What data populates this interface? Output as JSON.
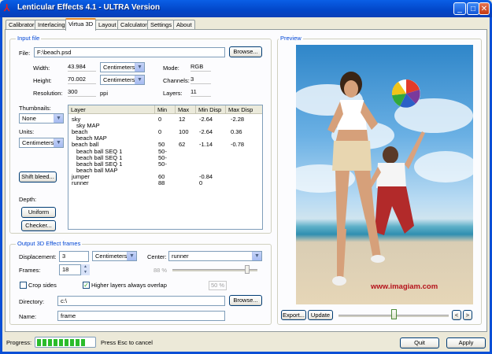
{
  "window": {
    "title": "Lenticular Effects 4.1 - ULTRA Version"
  },
  "tabs": [
    "Calibrator",
    "Interlacing",
    "Virtua 3D",
    "Layout",
    "Calculator",
    "Settings",
    "About"
  ],
  "input_file": {
    "group_title": "Input file",
    "file_label": "File:",
    "file_value": "F:\\beach.psd",
    "browse_label": "Browse...",
    "width_label": "Width:",
    "width_value": "43.984",
    "width_unit": "Centimeters",
    "height_label": "Height:",
    "height_value": "70.002",
    "height_unit": "Centimeters",
    "resolution_label": "Resolution:",
    "resolution_value": "300",
    "resolution_unit": "ppi",
    "mode_label": "Mode:",
    "mode_value": "RGB",
    "channels_label": "Channels:",
    "channels_value": "3",
    "layers_label": "Layers:",
    "layers_value": "11",
    "thumbnails_label": "Thumbnails:",
    "thumbnails_value": "None",
    "units_label": "Units:",
    "units_value": "Centimeters",
    "shift_bleed_label": "Shift bleed...",
    "depth_label": "Depth:",
    "uniform_label": "Uniform",
    "checker_label": "Checker..."
  },
  "layer_table": {
    "headers": [
      "Layer",
      "Min",
      "Max",
      "Min Disp",
      "Max Disp"
    ],
    "rows": [
      [
        "sky",
        "0",
        "12",
        "-2.64",
        "-2.28"
      ],
      [
        "  sky MAP",
        "",
        "",
        "",
        ""
      ],
      [
        "beach",
        "0",
        "100",
        "-2.64",
        "0.36"
      ],
      [
        "  beach MAP",
        "",
        "",
        "",
        ""
      ],
      [
        "beach ball",
        "50",
        "62",
        "-1.14",
        "-0.78"
      ],
      [
        "  beach ball SEQ 1",
        "50-",
        "",
        "",
        ""
      ],
      [
        "  beach ball SEQ 1",
        "50-",
        "",
        "",
        ""
      ],
      [
        "  beach ball SEQ 1",
        "50-",
        "",
        "",
        ""
      ],
      [
        "  beach ball MAP",
        "",
        "",
        "",
        ""
      ],
      [
        "jumper",
        "60",
        "",
        "-0.84",
        ""
      ],
      [
        "runner",
        "88",
        "",
        "0",
        ""
      ]
    ]
  },
  "output": {
    "group_title": "Output 3D Effect frames",
    "displacement_label": "Displacement:",
    "displacement_value": "3",
    "displacement_unit": "Centimeters",
    "center_label": "Center:",
    "center_value": "runner",
    "frames_label": "Frames:",
    "frames_value": "18",
    "slider_pct_left": "88 %",
    "slider_left_level": 0.88,
    "slider_pct_right": "50 %",
    "crop_sides_label": "Crop sides",
    "crop_sides_checked": false,
    "higher_layers_label": "Higher layers always overlap",
    "higher_layers_checked": true,
    "directory_label": "Directory:",
    "directory_value": "c:\\",
    "browse_label": "Browse...",
    "name_label": "Name:",
    "name_value": "frame"
  },
  "preview": {
    "group_title": "Preview",
    "watermark": "www.imagiam.com",
    "export_label": "Export...",
    "update_label": "Update",
    "slider_level": 0.5,
    "prev_label": "<",
    "next_label": ">"
  },
  "status": {
    "progress_label": "Progress:",
    "progress_cells": 9,
    "hint": "Press Esc to cancel",
    "quit_label": "Quit",
    "apply_label": "Apply"
  }
}
